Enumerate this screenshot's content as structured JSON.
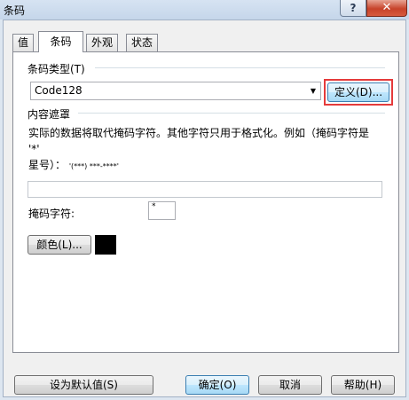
{
  "window": {
    "title": "条码",
    "help_glyph": "?",
    "close_glyph": "✕"
  },
  "tabs": [
    {
      "label": "值"
    },
    {
      "label": "条码"
    },
    {
      "label": "外观"
    },
    {
      "label": "状态"
    }
  ],
  "barcode_type": {
    "group_label": "条码类型(T)",
    "selected": "Code128",
    "define_button": "定义(D)..."
  },
  "content_mask": {
    "group_label": "内容遮罩",
    "description_line1": "实际的数据将取代掩码字符。其他字符只用于格式化。例如（掩码字符是 '*'",
    "description_line2_prefix": "星号）：",
    "description_line2_sample": "'(***) ***-****'",
    "mask_value": "",
    "mask_char_label": "掩码字符:",
    "mask_char_value": "*",
    "color_button": "颜色(L)...",
    "color_value": "#000000"
  },
  "footer": {
    "set_default": "设为默认值(S)",
    "ok": "确定(O)",
    "cancel": "取消",
    "help": "帮助(H)"
  }
}
